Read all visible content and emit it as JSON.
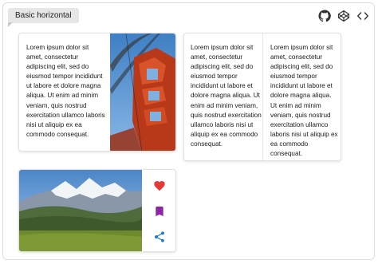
{
  "header": {
    "tag_label": "Basic horizontal",
    "icons": [
      "github-icon",
      "codepen-icon",
      "code-icon"
    ]
  },
  "cards": {
    "card1_text": "Lorem ipsum dolor sit amet, consectetur adipiscing elit, sed do eiusmod tempor incididunt ut labore et dolore magna aliqua. Ut enim ad minim veniam, quis nostrud exercitation ullamco laboris nisi ut aliquip ex ea commodo consequat.",
    "card2_left_text": "Lorem ipsum dolor sit amet, consectetur adipiscing elit, sed do eiusmod tempor incididunt ut labore et dolore magna aliqua. Ut enim ad minim veniam, quis nostrud exercitation ullamco laboris nisi ut aliquip ex ea commodo consequat.",
    "card2_right_text": "Lorem ipsum dolor sit amet, consectetur adipiscing elit, sed do eiusmod tempor incididunt ut labore et dolore magna aliqua. Ut enim ad minim veniam, quis nostrud exercitation ullamco laboris nisi ut aliquip ex ea commodo consequat.",
    "card3_actions": [
      "heart-icon",
      "bookmark-icon",
      "share-icon"
    ]
  },
  "colors": {
    "heart": "#e53935",
    "bookmark": "#8e24aa",
    "share": "#1976d2",
    "bridge": "#c0421c",
    "sky": "#4a90d9"
  }
}
